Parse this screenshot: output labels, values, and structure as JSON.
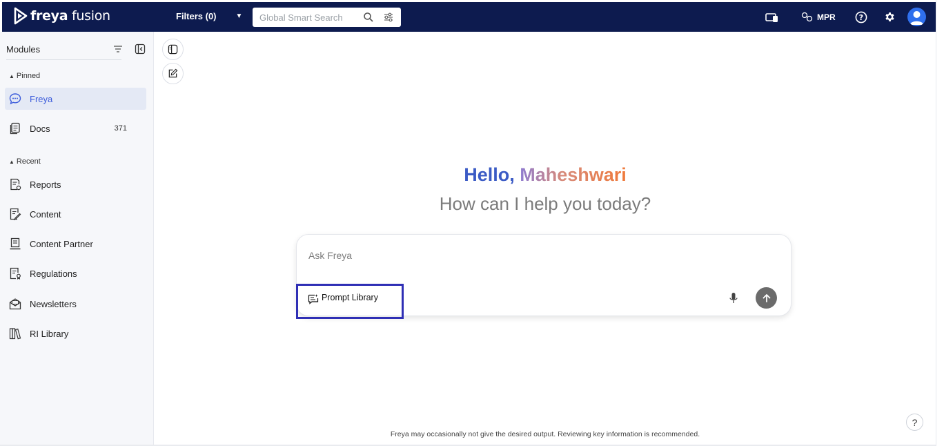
{
  "app": {
    "logo_text_left": "freya",
    "logo_text_right": "fusion"
  },
  "topbar": {
    "filters_label": "Filters (0)",
    "search_placeholder": "Global Smart Search",
    "mpr_label": "MPR"
  },
  "sidebar": {
    "title": "Modules",
    "pinned_label": "Pinned",
    "recent_label": "Recent",
    "pinned_items": [
      {
        "label": "Freya",
        "icon": "chat-bubble-icon",
        "active": true
      },
      {
        "label": "Docs",
        "icon": "docs-icon",
        "count": "371"
      }
    ],
    "recent_items": [
      {
        "label": "Reports",
        "icon": "report-icon"
      },
      {
        "label": "Content",
        "icon": "content-edit-icon"
      },
      {
        "label": "Content Partner",
        "icon": "content-partner-icon"
      },
      {
        "label": "Regulations",
        "icon": "regulations-icon"
      },
      {
        "label": "Newsletters",
        "icon": "newsletter-icon"
      },
      {
        "label": "RI Library",
        "icon": "library-icon"
      }
    ]
  },
  "main": {
    "greeting_hello": "Hello,",
    "greeting_name": "Maheshwari",
    "subtitle": "How can I help you today?",
    "ask_placeholder": "Ask Freya",
    "prompt_library_label": "Prompt Library",
    "disclaimer": "Freya may occasionally not give the desired output. Reviewing key information is recommended.",
    "help_label": "?"
  },
  "colors": {
    "topbar_bg": "#0d1b4f",
    "accent_blue": "#3b5bc5",
    "name_gradient_end": "#f07a3a",
    "highlight_box": "#2f2fb5"
  }
}
